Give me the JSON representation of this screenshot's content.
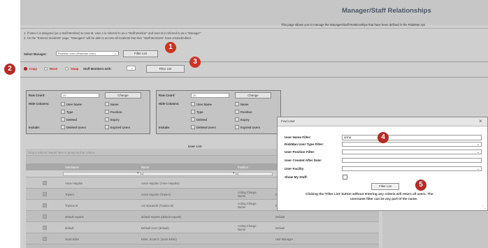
{
  "header": {
    "title": "Manager/Staff Relationships",
    "description": "This page allows you to manage the Manager/Staff Relationships that have been defined in the RiskMan sys"
  },
  "notes": [
    "1.  If User A is assigned (as a Staff Member) to User B, User A is referred to as a \"Staff Member\" and User B is referred to as a \"Manager\".",
    "2.  On the \"Entered Incidents\" page, \"Managers\" will be able to access all incidents that their \"Staff Members\" have created/edited."
  ],
  "manager_select": {
    "label": "Select Manager:",
    "value": "RiskMan User  (RiskMan User)",
    "button": "Filter List"
  },
  "mode": {
    "copy": "Copy",
    "move": "Move",
    "swap": "Swap",
    "staff_label": "Staff Members with:",
    "button": "Filter List"
  },
  "left_panel": {
    "row_count_label": "Row Count:",
    "row_count_value": "20",
    "change_button": "Change",
    "hide_columns_label": "Hide Columns:",
    "include_label": "Include:",
    "options": [
      "User Name",
      "Name",
      "Type",
      "Position",
      "Deleted",
      "Expiry",
      "Deleted Users",
      "Expired Users"
    ]
  },
  "right_panel": {
    "row_count_label": "Row Count:",
    "row_count_value": "20",
    "change_button": "Change",
    "hide_columns_label": "Hide Columns:",
    "include_label": "Include:",
    "options": [
      "User Name",
      "Name",
      "Type",
      "Position",
      "Deleted",
      "Expiry",
      "Deleted Users",
      "Expired Users"
    ]
  },
  "user_list": {
    "title": "User List",
    "group_hint": "Drag a column header here to group by that column",
    "columns": [
      "UserName",
      "Name",
      "Position"
    ],
    "rows": [
      {
        "username": "Anne Hayden",
        "name": "Anne Hayden (Anne Hayden)",
        "position": "",
        "extra": ""
      },
      {
        "username": "Trainer",
        "name": "Anne Hayden (Trainer)",
        "position": "Acting Charge Nurse",
        "extra": "Default"
      },
      {
        "username": "Trainee B",
        "name": "Ani Nazareth (Trainee B)",
        "position": "Acting Charge Nurse",
        "extra": "Default"
      },
      {
        "username": "default reports",
        "name": "default reports (default reports)",
        "position": "",
        "extra": "Default"
      },
      {
        "username": "default",
        "name": "Default User (default)",
        "position": "Acting Charge Nurse",
        "extra": "Default"
      },
      {
        "username": "Scott Ekler",
        "name": "Ekler, Scott D. (Scott Ekler)",
        "position": "",
        "extra": "Unit Manager"
      }
    ]
  },
  "dialog": {
    "title": "Find User",
    "close": "×",
    "fields": {
      "user_name_filter": {
        "label": "User Name Filter:",
        "value": "anna"
      },
      "user_type_filter": {
        "label": "RiskMan User Type Filter:"
      },
      "position_filter": {
        "label": "User Position Filter:"
      },
      "created_after": {
        "label": "User Created After Date:"
      },
      "facility": {
        "label": "User Facility"
      },
      "show_my_staff": {
        "label": "Show My Staff:"
      }
    },
    "button": "Filter List",
    "help": [
      "Clicking the 'Filter List' button without entering any criteria will return all users. The",
      "username filter can be any part of the name."
    ]
  },
  "badges": [
    "1",
    "2",
    "3",
    "4",
    "5"
  ],
  "colors": {
    "badge_red": "#cc3322",
    "badge_dark": "#b52a24",
    "title": "#4a5668",
    "copy_red": "#cc2222"
  }
}
